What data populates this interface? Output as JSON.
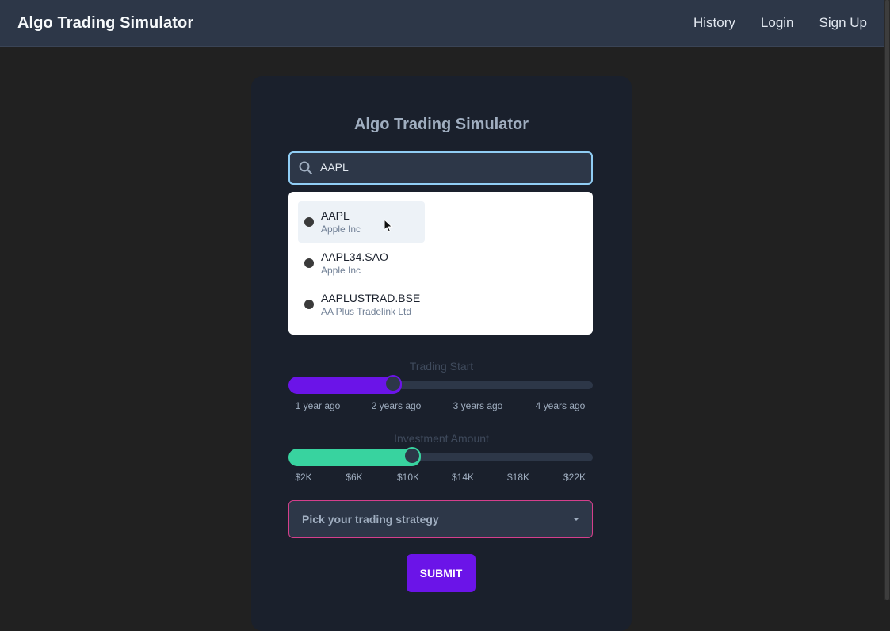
{
  "navbar": {
    "brand": "Algo Trading Simulator",
    "links": [
      {
        "label": "History"
      },
      {
        "label": "Login"
      },
      {
        "label": "Sign Up"
      }
    ]
  },
  "card": {
    "title": "Algo Trading Simulator"
  },
  "search": {
    "value": "AAPL",
    "focused": true,
    "icon": "search-icon",
    "results": [
      {
        "symbol": "AAPL",
        "name": "Apple Inc",
        "hovered": true
      },
      {
        "symbol": "AAPL34.SAO",
        "name": "Apple Inc",
        "hovered": false
      },
      {
        "symbol": "AAPLUSTRAD.BSE",
        "name": "AA Plus Tradelink Ltd",
        "hovered": false
      }
    ]
  },
  "trading_start": {
    "label": "Trading Start",
    "ticks": [
      "1 year ago",
      "2 years ago",
      "3 years ago",
      "4 years ago"
    ],
    "value_fraction": 0.345,
    "fill_color": "#6b14e8",
    "thumb_border": "#6b14e8"
  },
  "investment_amount": {
    "label": "Investment Amount",
    "ticks": [
      "$2K",
      "$6K",
      "$10K",
      "$14K",
      "$18K",
      "$22K"
    ],
    "value_fraction": 0.407,
    "fill_color": "#38d39f",
    "thumb_border": "#38d39f"
  },
  "strategy": {
    "placeholder": "Pick your trading strategy",
    "border_color": "#d53f8c"
  },
  "submit": {
    "label": "SUBMIT",
    "color": "#6b14e8"
  }
}
